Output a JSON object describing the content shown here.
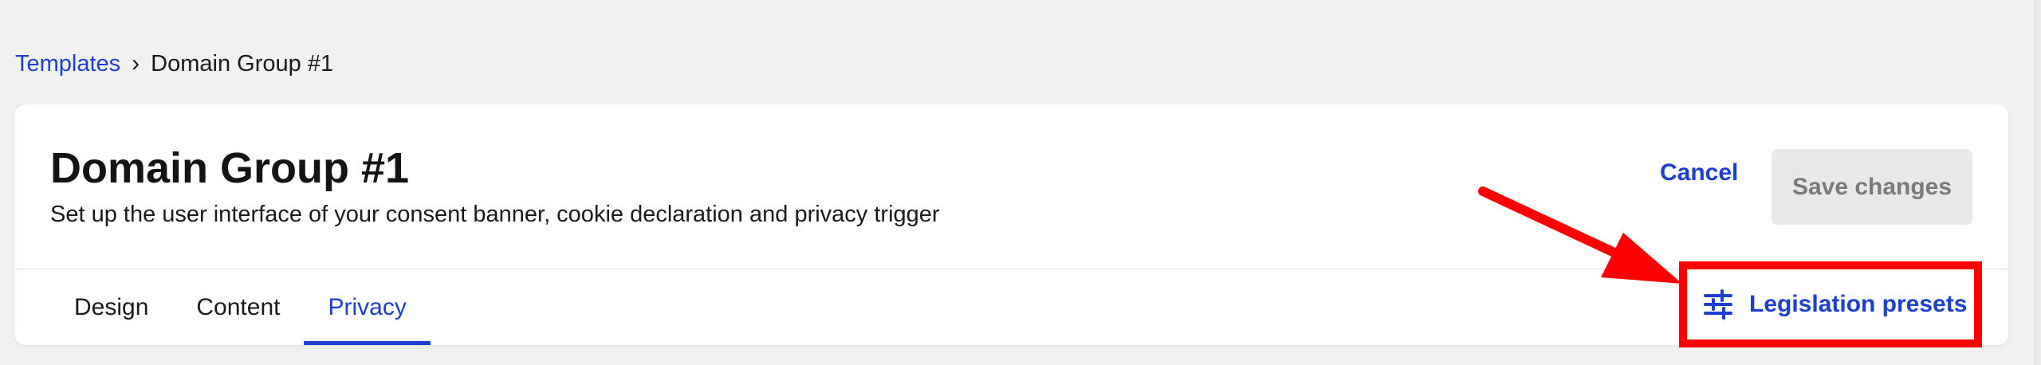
{
  "breadcrumb": {
    "parent": "Templates",
    "separator": "›",
    "current": "Domain Group #1"
  },
  "header": {
    "title": "Domain Group #1",
    "subtitle": "Set up the user interface of your consent banner, cookie declaration and privacy trigger"
  },
  "actions": {
    "cancel_label": "Cancel",
    "save_label": "Save changes",
    "legislation_label": "Legislation presets"
  },
  "tabs": [
    {
      "label": "Design",
      "active": false
    },
    {
      "label": "Content",
      "active": false
    },
    {
      "label": "Privacy",
      "active": true
    }
  ],
  "icons": {
    "legislation": "sliders-icon"
  },
  "colors": {
    "accent": "#1d3fcf",
    "highlight": "#ff0000",
    "background": "#f1f1f1"
  }
}
